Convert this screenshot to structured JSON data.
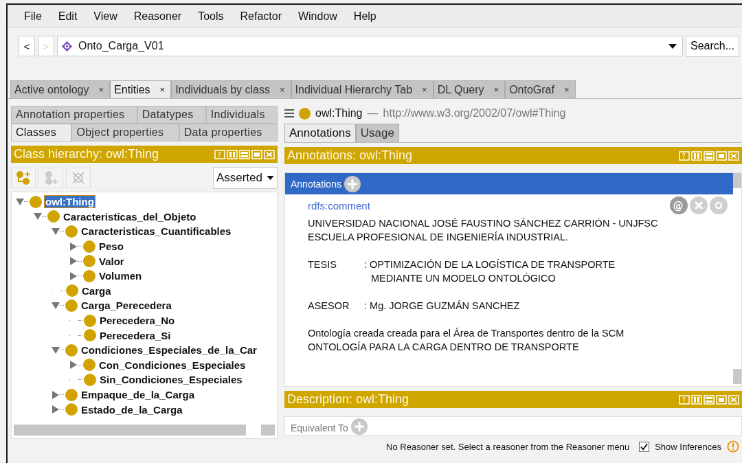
{
  "menu": [
    "File",
    "Edit",
    "View",
    "Reasoner",
    "Tools",
    "Refactor",
    "Window",
    "Help"
  ],
  "nav": {
    "back": {
      "label": "<",
      "disabled": false
    },
    "forward": {
      "label": ">",
      "disabled": true
    },
    "ontology": "Onto_Carga_V01",
    "search": "Search..."
  },
  "tabs": [
    {
      "label": "Active ontology",
      "close": "×",
      "selected": false
    },
    {
      "label": "Entities",
      "close": "×",
      "selected": true
    },
    {
      "label": "Individuals by class",
      "close": "×",
      "selected": false
    },
    {
      "label": "Individual Hierarchy Tab",
      "close": "×",
      "selected": false
    },
    {
      "label": "DL Query",
      "close": "×",
      "selected": false
    },
    {
      "label": "OntoGraf",
      "close": "×",
      "selected": false
    }
  ],
  "entity_tabs": [
    [
      {
        "label": "Annotation properties",
        "selected": false
      },
      {
        "label": "Datatypes",
        "selected": false
      },
      {
        "label": "Individuals",
        "selected": false
      }
    ],
    [
      {
        "label": "Classes",
        "selected": true
      },
      {
        "label": "Object properties",
        "selected": false
      },
      {
        "label": "Data properties",
        "selected": false
      }
    ]
  ],
  "class_hierarchy": {
    "title": "Class hierarchy: owl:Thing",
    "help": "?",
    "mode": "Asserted",
    "tree": [
      {
        "label": "owl:Thing",
        "kind": "open",
        "selected": true,
        "children": [
          {
            "label": "Caracteristicas_del_Objeto",
            "kind": "open",
            "selected": false,
            "children": [
              {
                "label": "Caracteristicas_Cuantificables",
                "kind": "open",
                "selected": false,
                "children": [
                  {
                    "label": "Peso",
                    "kind": "closed",
                    "selected": false
                  },
                  {
                    "label": "Valor",
                    "kind": "closed",
                    "selected": false
                  },
                  {
                    "label": "Volumen",
                    "kind": "closed",
                    "selected": false
                  }
                ]
              },
              {
                "label": "Carga",
                "kind": "leaf",
                "selected": false
              },
              {
                "label": "Carga_Perecedera",
                "kind": "open",
                "selected": false,
                "children": [
                  {
                    "label": "Perecedera_No",
                    "kind": "leaf",
                    "selected": false
                  },
                  {
                    "label": "Perecedera_Si",
                    "kind": "leaf",
                    "selected": false
                  }
                ]
              },
              {
                "label": "Condiciones_Especiales_de_la_Car",
                "kind": "open",
                "selected": false,
                "children": [
                  {
                    "label": "Con_Condiciones_Especiales",
                    "kind": "closed",
                    "selected": false
                  },
                  {
                    "label": "Sin_Condiciones_Especiales",
                    "kind": "leaf",
                    "selected": false
                  }
                ]
              },
              {
                "label": "Empaque_de_la_Carga",
                "kind": "closed",
                "selected": false
              },
              {
                "label": "Estado_de_la_Carga",
                "kind": "closed",
                "selected": false
              }
            ]
          }
        ]
      }
    ]
  },
  "entity": {
    "name": "owl:Thing",
    "separator": "—",
    "iri": "http://www.w3.org/2002/07/owl#Thing"
  },
  "view_tabs": [
    {
      "label": "Annotations",
      "selected": true
    },
    {
      "label": "Usage",
      "selected": false
    }
  ],
  "annotations": {
    "title": "Annotations: owl:Thing",
    "help": "?",
    "section": "Annotations",
    "property": "rdfs:comment",
    "reference": "@",
    "blocks": [
      {
        "kind": "para",
        "lines": [
          "UNIVERSIDAD NACIONAL JOSÉ FAUSTINO SÁNCHEZ CARRIÓN - UNJFSC",
          "ESCUELA PROFESIONAL DE INGENIERÍA INDUSTRIAL."
        ]
      },
      {
        "kind": "field",
        "label": "TESIS",
        "lines": [
          ": OPTIMIZACIÓN DE LA LOGÍSTICA DE TRANSPORTE",
          "MEDIANTE UN MODELO ONTOLÓGICO"
        ]
      },
      {
        "kind": "field",
        "label": "ASESOR",
        "lines": [
          ": Mg. JORGE GUZMÁN SANCHEZ"
        ]
      },
      {
        "kind": "para",
        "lines": [
          "Ontología creada creada para el Área de Transportes dentro de la SCM",
          "ONTOLOGÍA PARA LA CARGA DENTRO DE TRANSPORTE"
        ]
      }
    ]
  },
  "description": {
    "title": "Description: owl:Thing",
    "help": "?",
    "section": "Equivalent To"
  },
  "status": {
    "message": "No Reasoner set. Select a reasoner from the Reasoner menu",
    "show_inferences": {
      "label": "Show Inferences",
      "checked": true
    }
  }
}
